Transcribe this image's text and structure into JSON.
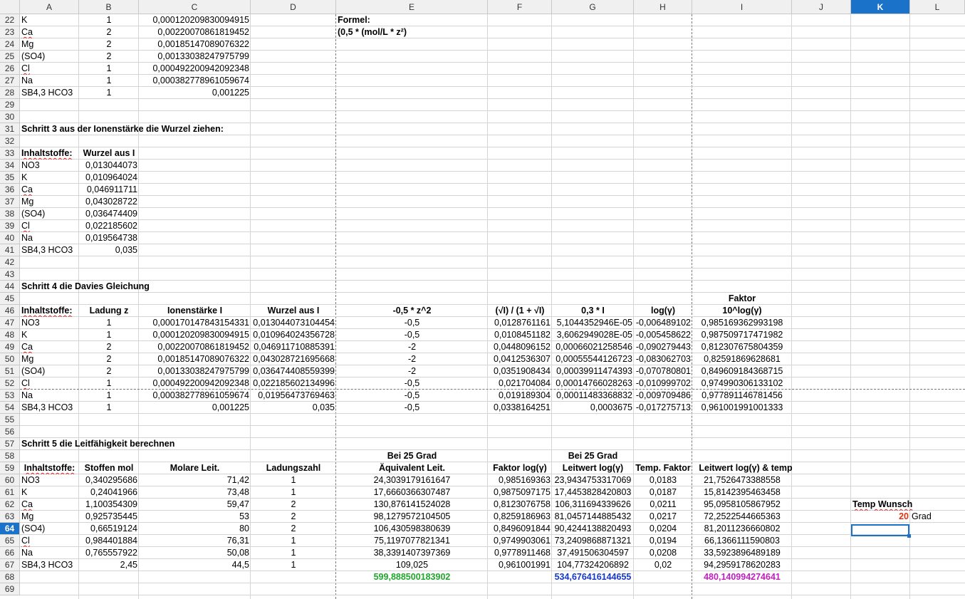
{
  "columns": [
    "A",
    "B",
    "C",
    "D",
    "E",
    "F",
    "G",
    "H",
    "I",
    "J",
    "K",
    "L"
  ],
  "selected_column": "K",
  "selected_row": "64",
  "rows": [
    {
      "n": "22",
      "cells": {
        "A": "K",
        "B": "1",
        "C": "0,000120209830094915"
      }
    },
    {
      "n": "23",
      "cells": {
        "A": "Ca",
        "B": "2",
        "C": "0,00220070861819452"
      }
    },
    {
      "n": "24",
      "cells": {
        "A": "Mg",
        "B": "2",
        "C": "0,00185147089076322"
      }
    },
    {
      "n": "25",
      "cells": {
        "A": "(SO4)",
        "B": "2",
        "C": "0,00133038247975799"
      }
    },
    {
      "n": "26",
      "cells": {
        "A": "Cl",
        "B": "1",
        "C": "0,000492200942092348"
      }
    },
    {
      "n": "27",
      "cells": {
        "A": "Na",
        "B": "1",
        "C": "0,000382778961059674"
      }
    },
    {
      "n": "28",
      "cells": {
        "A": "SB4,3 HCO3",
        "B": "1",
        "C": "0,001225"
      }
    },
    {
      "n": "29",
      "cells": {}
    },
    {
      "n": "30",
      "cells": {}
    },
    {
      "n": "31",
      "cells": {
        "A": "Schritt 3 aus der Ionenstärke die Wurzel ziehen:"
      }
    },
    {
      "n": "32",
      "cells": {}
    },
    {
      "n": "33",
      "cells": {
        "A": "Inhaltstoffe:",
        "B": "Wurzel aus I"
      }
    },
    {
      "n": "34",
      "cells": {
        "A": "NO3",
        "B": "0,013044073"
      }
    },
    {
      "n": "35",
      "cells": {
        "A": "K",
        "B": "0,010964024"
      }
    },
    {
      "n": "36",
      "cells": {
        "A": "Ca",
        "B": "0,046911711"
      }
    },
    {
      "n": "37",
      "cells": {
        "A": "Mg",
        "B": "0,043028722"
      }
    },
    {
      "n": "38",
      "cells": {
        "A": "(SO4)",
        "B": "0,036474409"
      }
    },
    {
      "n": "39",
      "cells": {
        "A": "Cl",
        "B": "0,022185602"
      }
    },
    {
      "n": "40",
      "cells": {
        "A": "Na",
        "B": "0,019564738"
      }
    },
    {
      "n": "41",
      "cells": {
        "A": "SB4,3 HCO3",
        "B": "0,035"
      }
    },
    {
      "n": "42",
      "cells": {}
    },
    {
      "n": "43",
      "cells": {}
    },
    {
      "n": "44",
      "cells": {
        "A": "Schritt 4 die Davies Gleichung"
      }
    },
    {
      "n": "45",
      "cells": {
        "I": "Faktor"
      }
    },
    {
      "n": "46",
      "cells": {
        "A": "Inhaltstoffe:",
        "B": "Ladung z",
        "C": "Ionenstärke I",
        "D": "Wurzel aus I",
        "E": "-0,5 * z^2",
        "F": "(√I) / (1 + √I)",
        "G": "0,3 * I",
        "H": "log(γ)",
        "I": "10^log(γ)"
      }
    },
    {
      "n": "47",
      "cells": {
        "A": "NO3",
        "B": "1",
        "C": "0,000170147843154331",
        "D": "0,013044073104454",
        "E": "-0,5",
        "F": "0,0128761161",
        "G": "5,1044352946E-05",
        "H": "-0,006489102",
        "I": "0,985169362993198"
      }
    },
    {
      "n": "48",
      "cells": {
        "A": "K",
        "B": "1",
        "C": "0,000120209830094915",
        "D": "0,010964024356728",
        "E": "-0,5",
        "F": "0,0108451182",
        "G": "3,6062949028E-05",
        "H": "-0,005458622",
        "I": "0,987509717471982"
      }
    },
    {
      "n": "49",
      "cells": {
        "A": "Ca",
        "B": "2",
        "C": "0,00220070861819452",
        "D": "0,046911710885391",
        "E": "-2",
        "F": "0,0448096152",
        "G": "0,00066021258546",
        "H": "-0,090279443",
        "I": "0,812307675804359"
      }
    },
    {
      "n": "50",
      "cells": {
        "A": "Mg",
        "B": "2",
        "C": "0,00185147089076322",
        "D": "0,043028721695668",
        "E": "-2",
        "F": "0,0412536307",
        "G": "0,00055544126723",
        "H": "-0,083062703",
        "I": "0,82591869628681"
      }
    },
    {
      "n": "51",
      "cells": {
        "A": "(SO4)",
        "B": "2",
        "C": "0,00133038247975799",
        "D": "0,036474408559399",
        "E": "-2",
        "F": "0,0351908434",
        "G": "0,00039911474393",
        "H": "-0,070780801",
        "I": "0,849609184368715"
      }
    },
    {
      "n": "52",
      "cells": {
        "A": "Cl",
        "B": "1",
        "C": "0,000492200942092348",
        "D": "0,022185602134996",
        "E": "-0,5",
        "F": "0,021704084",
        "G": "0,00014766028263",
        "H": "-0,010999702",
        "I": "0,974990306133102"
      }
    },
    {
      "n": "53",
      "cells": {
        "A": "Na",
        "B": "1",
        "C": "0,000382778961059674",
        "D": "0,01956473769463",
        "E": "-0,5",
        "F": "0,019189304",
        "G": "0,00011483368832",
        "H": "-0,009709486",
        "I": "0,977891146781456"
      }
    },
    {
      "n": "54",
      "cells": {
        "A": "SB4,3 HCO3",
        "B": "1",
        "C": "0,001225",
        "D": "0,035",
        "E": "-0,5",
        "F": "0,0338164251",
        "G": "0,0003675",
        "H": "-0,017275713",
        "I": "0,961001991001333"
      }
    },
    {
      "n": "55",
      "cells": {}
    },
    {
      "n": "56",
      "cells": {}
    },
    {
      "n": "57",
      "cells": {
        "A": "Schritt 5 die Leitfähigkeit berechnen"
      }
    },
    {
      "n": "58",
      "cells": {
        "E": "Bei 25 Grad",
        "G": "Bei 25 Grad"
      }
    },
    {
      "n": "59",
      "cells": {
        "A": "Inhaltstoffe:",
        "B": "Stoffen mol",
        "C": "Molare Leit.",
        "D": "Ladungszahl",
        "E": "Äquivalent Leit.",
        "F": "Faktor log(γ)",
        "G": "Leitwert log(γ)",
        "H": "Temp. Faktor",
        "I": "Leitwert log(γ) & temp"
      }
    },
    {
      "n": "60",
      "cells": {
        "A": "NO3",
        "B": "0,340295686",
        "C": "71,42",
        "D": "1",
        "E": "24,3039179161647",
        "F": "0,985169363",
        "G": "23,9434753317069",
        "H": "0,0183",
        "I": "21,7526473388558"
      }
    },
    {
      "n": "61",
      "cells": {
        "A": "K",
        "B": "0,24041966",
        "C": "73,48",
        "D": "1",
        "E": "17,6660366307487",
        "F": "0,9875097175",
        "G": "17,4453828420803",
        "H": "0,0187",
        "I": "15,8142395463458"
      }
    },
    {
      "n": "62",
      "cells": {
        "A": "Ca",
        "B": "1,100354309",
        "C": "59,47",
        "D": "2",
        "E": "130,876141524028",
        "F": "0,8123076758",
        "G": "106,311694339626",
        "H": "0,0211",
        "I": "95,0958105867952",
        "K": "Temp Wunsch"
      }
    },
    {
      "n": "63",
      "cells": {
        "A": "Mg",
        "B": "0,925735445",
        "C": "53",
        "D": "2",
        "E": "98,1279572104505",
        "F": "0,8259186963",
        "G": "81,0457144885432",
        "H": "0,0217",
        "I": "72,2522544665363",
        "K": "20",
        "L": "Grad"
      }
    },
    {
      "n": "64",
      "cells": {
        "A": "(SO4)",
        "B": "0,66519124",
        "C": "80",
        "D": "2",
        "E": "106,430598380639",
        "F": "0,8496091844",
        "G": "90,4244138820493",
        "H": "0,0204",
        "I": "81,2011236660802"
      }
    },
    {
      "n": "65",
      "cells": {
        "A": "Cl",
        "B": "0,984401884",
        "C": "76,31",
        "D": "1",
        "E": "75,1197077821341",
        "F": "0,9749903061",
        "G": "73,2409868871321",
        "H": "0,0194",
        "I": "66,1366111590803"
      }
    },
    {
      "n": "66",
      "cells": {
        "A": "Na",
        "B": "0,765557922",
        "C": "50,08",
        "D": "1",
        "E": "38,3391407397369",
        "F": "0,9778911468",
        "G": "37,491506304597",
        "H": "0,0208",
        "I": "33,5923896489189"
      }
    },
    {
      "n": "67",
      "cells": {
        "A": "SB4,3 HCO3",
        "B": "2,45",
        "C": "44,5",
        "D": "1",
        "E": "109,025",
        "F": "0,961001991",
        "G": "104,77324206892",
        "H": "0,02",
        "I": "94,2959178620283"
      }
    },
    {
      "n": "68",
      "cells": {
        "E": "599,888500183902",
        "G": "534,676416144655",
        "I": "480,140994274641"
      }
    },
    {
      "n": "69",
      "cells": {}
    }
  ],
  "floating_text": {
    "formel_label": "Formel:",
    "formel_expr": "(0,5 * (mol/L * z²)"
  },
  "colors": {
    "selection": "#1a73c8",
    "sum_e": "#1fa82c",
    "sum_g": "#1638c8",
    "sum_i": "#c020c0",
    "temp_value": "#e03010"
  }
}
